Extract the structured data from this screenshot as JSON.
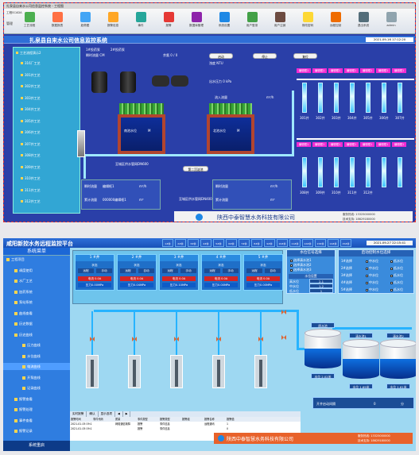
{
  "shotA": {
    "window_title": "扎泉县自来水公司信息监控系统 - 工程图",
    "tab_label": "工程SCADA",
    "menu_label": "管理",
    "ribbon": [
      {
        "label": "工艺流程",
        "icon": "flow-icon",
        "color": "#4caf50"
      },
      {
        "label": "数据报表",
        "icon": "report-icon",
        "color": "#ff7043"
      },
      {
        "label": "趋势图",
        "icon": "trend-icon",
        "color": "#42a5f5"
      },
      {
        "label": "报警信息",
        "icon": "bar-chart-icon",
        "color": "#ffa726"
      },
      {
        "label": "事件",
        "icon": "event-icon",
        "color": "#26a69a"
      },
      {
        "label": "报警",
        "icon": "alarm-icon",
        "color": "#e53935"
      },
      {
        "label": "数据库管理",
        "icon": "database-icon",
        "color": "#8e24aa"
      },
      {
        "label": "系统设置",
        "icon": "settings-icon",
        "color": "#1e88e5"
      },
      {
        "label": "用户登录",
        "icon": "user-icon",
        "color": "#43a047"
      },
      {
        "label": "用户注销",
        "icon": "logout-icon",
        "color": "#6d4c41"
      },
      {
        "label": "修改密码",
        "icon": "key-icon",
        "color": "#fdd835"
      },
      {
        "label": "远程控制",
        "icon": "remote-icon",
        "color": "#ef6c00"
      },
      {
        "label": "退出系统",
        "icon": "exit-icon",
        "color": "#546e7a"
      },
      {
        "label": "admin",
        "icon": "avatar-icon",
        "color": "#90a4ae"
      }
    ],
    "title": "扎泉县自来水公司信息监控系统",
    "clock": "2021-09-16 17:12:20",
    "tree_root": "工艺流程演示2",
    "tree_items": [
      "316厂工艺",
      "301井工艺",
      "302井工艺",
      "303井工艺",
      "304井工艺",
      "305井工艺",
      "306井工艺",
      "307井工艺",
      "308井工艺",
      "309井工艺",
      "310井工艺",
      "311井工艺",
      "312井工艺"
    ],
    "labels": {
      "dose1": "1#投药泵",
      "dose2": "2#投药泵",
      "flow_cm": "瞬时流量 CM",
      "chlorine": "余氯 0 / 0",
      "press": "出水压力 0 kPa",
      "inflow": "流入流量",
      "level": "液位 M",
      "turbidity": "浊度 NTU",
      "pool_left": "南池水位",
      "pool_right": "北池水位",
      "pool_unit": "M",
      "valve_note1": "至城区供水管网DN600",
      "valve_note2": "至城区供水管网DN400",
      "inst_flow": "瞬时流量",
      "total_flow": "累计流量",
      "flow_unit": "m³/h",
      "total_unit": "m³",
      "flow_val": "编辑框1",
      "total_val": "000000编辑框1",
      "btn_pool": "第二沉淀池",
      "btn_start": "启动",
      "btn_stop": "停止",
      "btn_reset": "复位",
      "well_tag": "编辑框1",
      "well_names": [
        "301井",
        "302井",
        "303井",
        "304井",
        "305井",
        "306井",
        "307井",
        "308井",
        "309井",
        "310井",
        "311井",
        "312井"
      ]
    },
    "footer_company": "陕西中泰智慧水务科技有限公司",
    "footer_phone": "服务热线: 13325000000",
    "footer_qq": "技术支持: 18629180000"
  },
  "shotB": {
    "title": "咸阳新控水务远程监控平台",
    "clock": "2021-09-27 22:15:41",
    "menu_header": "系统菜单",
    "menu_items": [
      {
        "label": "工程项目",
        "level": 0
      },
      {
        "label": "调度使用",
        "level": 1
      },
      {
        "label": "水厂工艺",
        "level": 1
      },
      {
        "label": "加药系统",
        "level": 1
      },
      {
        "label": "泵站系统",
        "level": 1
      },
      {
        "label": "曲线查看",
        "level": 1
      },
      {
        "label": "历史数据",
        "level": 1
      },
      {
        "label": "历史曲线",
        "level": 1
      },
      {
        "label": "压力曲线",
        "level": 2
      },
      {
        "label": "水位曲线",
        "level": 2
      },
      {
        "label": "电流曲线",
        "level": 2
      },
      {
        "label": "开泵曲线",
        "level": 2
      },
      {
        "label": "记录曲线",
        "level": 2
      },
      {
        "label": "报警查看",
        "level": 1
      },
      {
        "label": "报警处理",
        "level": 1
      },
      {
        "label": "事件查看",
        "level": 1
      },
      {
        "label": "报警记录",
        "level": 1
      }
    ],
    "restart": "系统重启",
    "nav_top": [
      "1#井",
      "2#井",
      "3#井",
      "4#井",
      "5#井",
      "6#井",
      "7#井",
      "8#井",
      "9#井",
      "10#井",
      "11#井",
      "12#井",
      "13#井",
      "14#井",
      "15#井"
    ],
    "wells": [
      {
        "name": "1 #井",
        "status": "状态",
        "remote": "远程",
        "manual": "手动",
        "current": "电流 0.0A",
        "pressure": "压力0.00MPa"
      },
      {
        "name": "2 #井",
        "status": "状态",
        "remote": "远程",
        "manual": "自动",
        "current": "电流 0.0A",
        "pressure": "压力0.04MPa"
      },
      {
        "name": "3 #井",
        "status": "状态",
        "remote": "远程",
        "manual": "手动",
        "current": "电流 0.0A",
        "pressure": "压力0.10MPa"
      },
      {
        "name": "4 #井",
        "status": "状态",
        "remote": "远程",
        "manual": "手动",
        "current": "电流 0.0A",
        "pressure": "压力0.00MPa"
      },
      {
        "name": "5 #井",
        "status": "状态",
        "remote": "远程",
        "manual": "自动",
        "current": "电流 0.0A",
        "pressure": "压力0.00MPa"
      }
    ],
    "level_select": {
      "title": "水位信号选择",
      "options": [
        "选择清水池1",
        "选择清水池2",
        "选择清水池3"
      ],
      "sub": "水位设置",
      "high": "高水位",
      "high_val": "2.1",
      "mid": "中水位",
      "mid_val": "1.2",
      "low": "低水位",
      "low_val": "1"
    },
    "auto_select": {
      "title": "启动控制水位选择",
      "rows": [
        [
          "1#选择",
          "中水位",
          "低水位"
        ],
        [
          "2#选择",
          "中水位",
          "低水位"
        ],
        [
          "3#选择",
          "中水位",
          "低水位"
        ],
        [
          "4#选择",
          "中水位",
          "低水位"
        ],
        [
          "5#选择",
          "中水位",
          "低水位"
        ]
      ]
    },
    "tanks": [
      {
        "name": "原水池",
        "level": "水位 2.02米"
      },
      {
        "name": "清水池1",
        "level": "水位 1.69米"
      },
      {
        "name": "清水池2",
        "level": "水位 1.61米"
      }
    ],
    "pump_interval": {
      "label": "开井启动间隔",
      "value": "0",
      "unit": "分"
    },
    "table": {
      "tabs": [
        "实时报警",
        "确认",
        "显示选项",
        "◀",
        "▶"
      ],
      "headers": [
        "报警时间",
        "事件代码",
        "质量",
        "事件类型",
        "报警类型",
        "报警组",
        "报警名称",
        "报警值"
      ],
      "rows": [
        [
          "2021-01-05 09:11:04",
          "",
          "网络通信故障",
          "报警",
          "事件信息",
          "",
          "远程通讯",
          "1"
        ],
        [
          "2021-01-05 09:11:04",
          "",
          "",
          "报警",
          "事件信息",
          "",
          "",
          "0"
        ]
      ]
    },
    "footer_company": "陕西中泰智慧水务科技有限公司",
    "footer_phone": "服务热线: 13325000000",
    "footer_qq": "技术支持: 18629180000"
  }
}
